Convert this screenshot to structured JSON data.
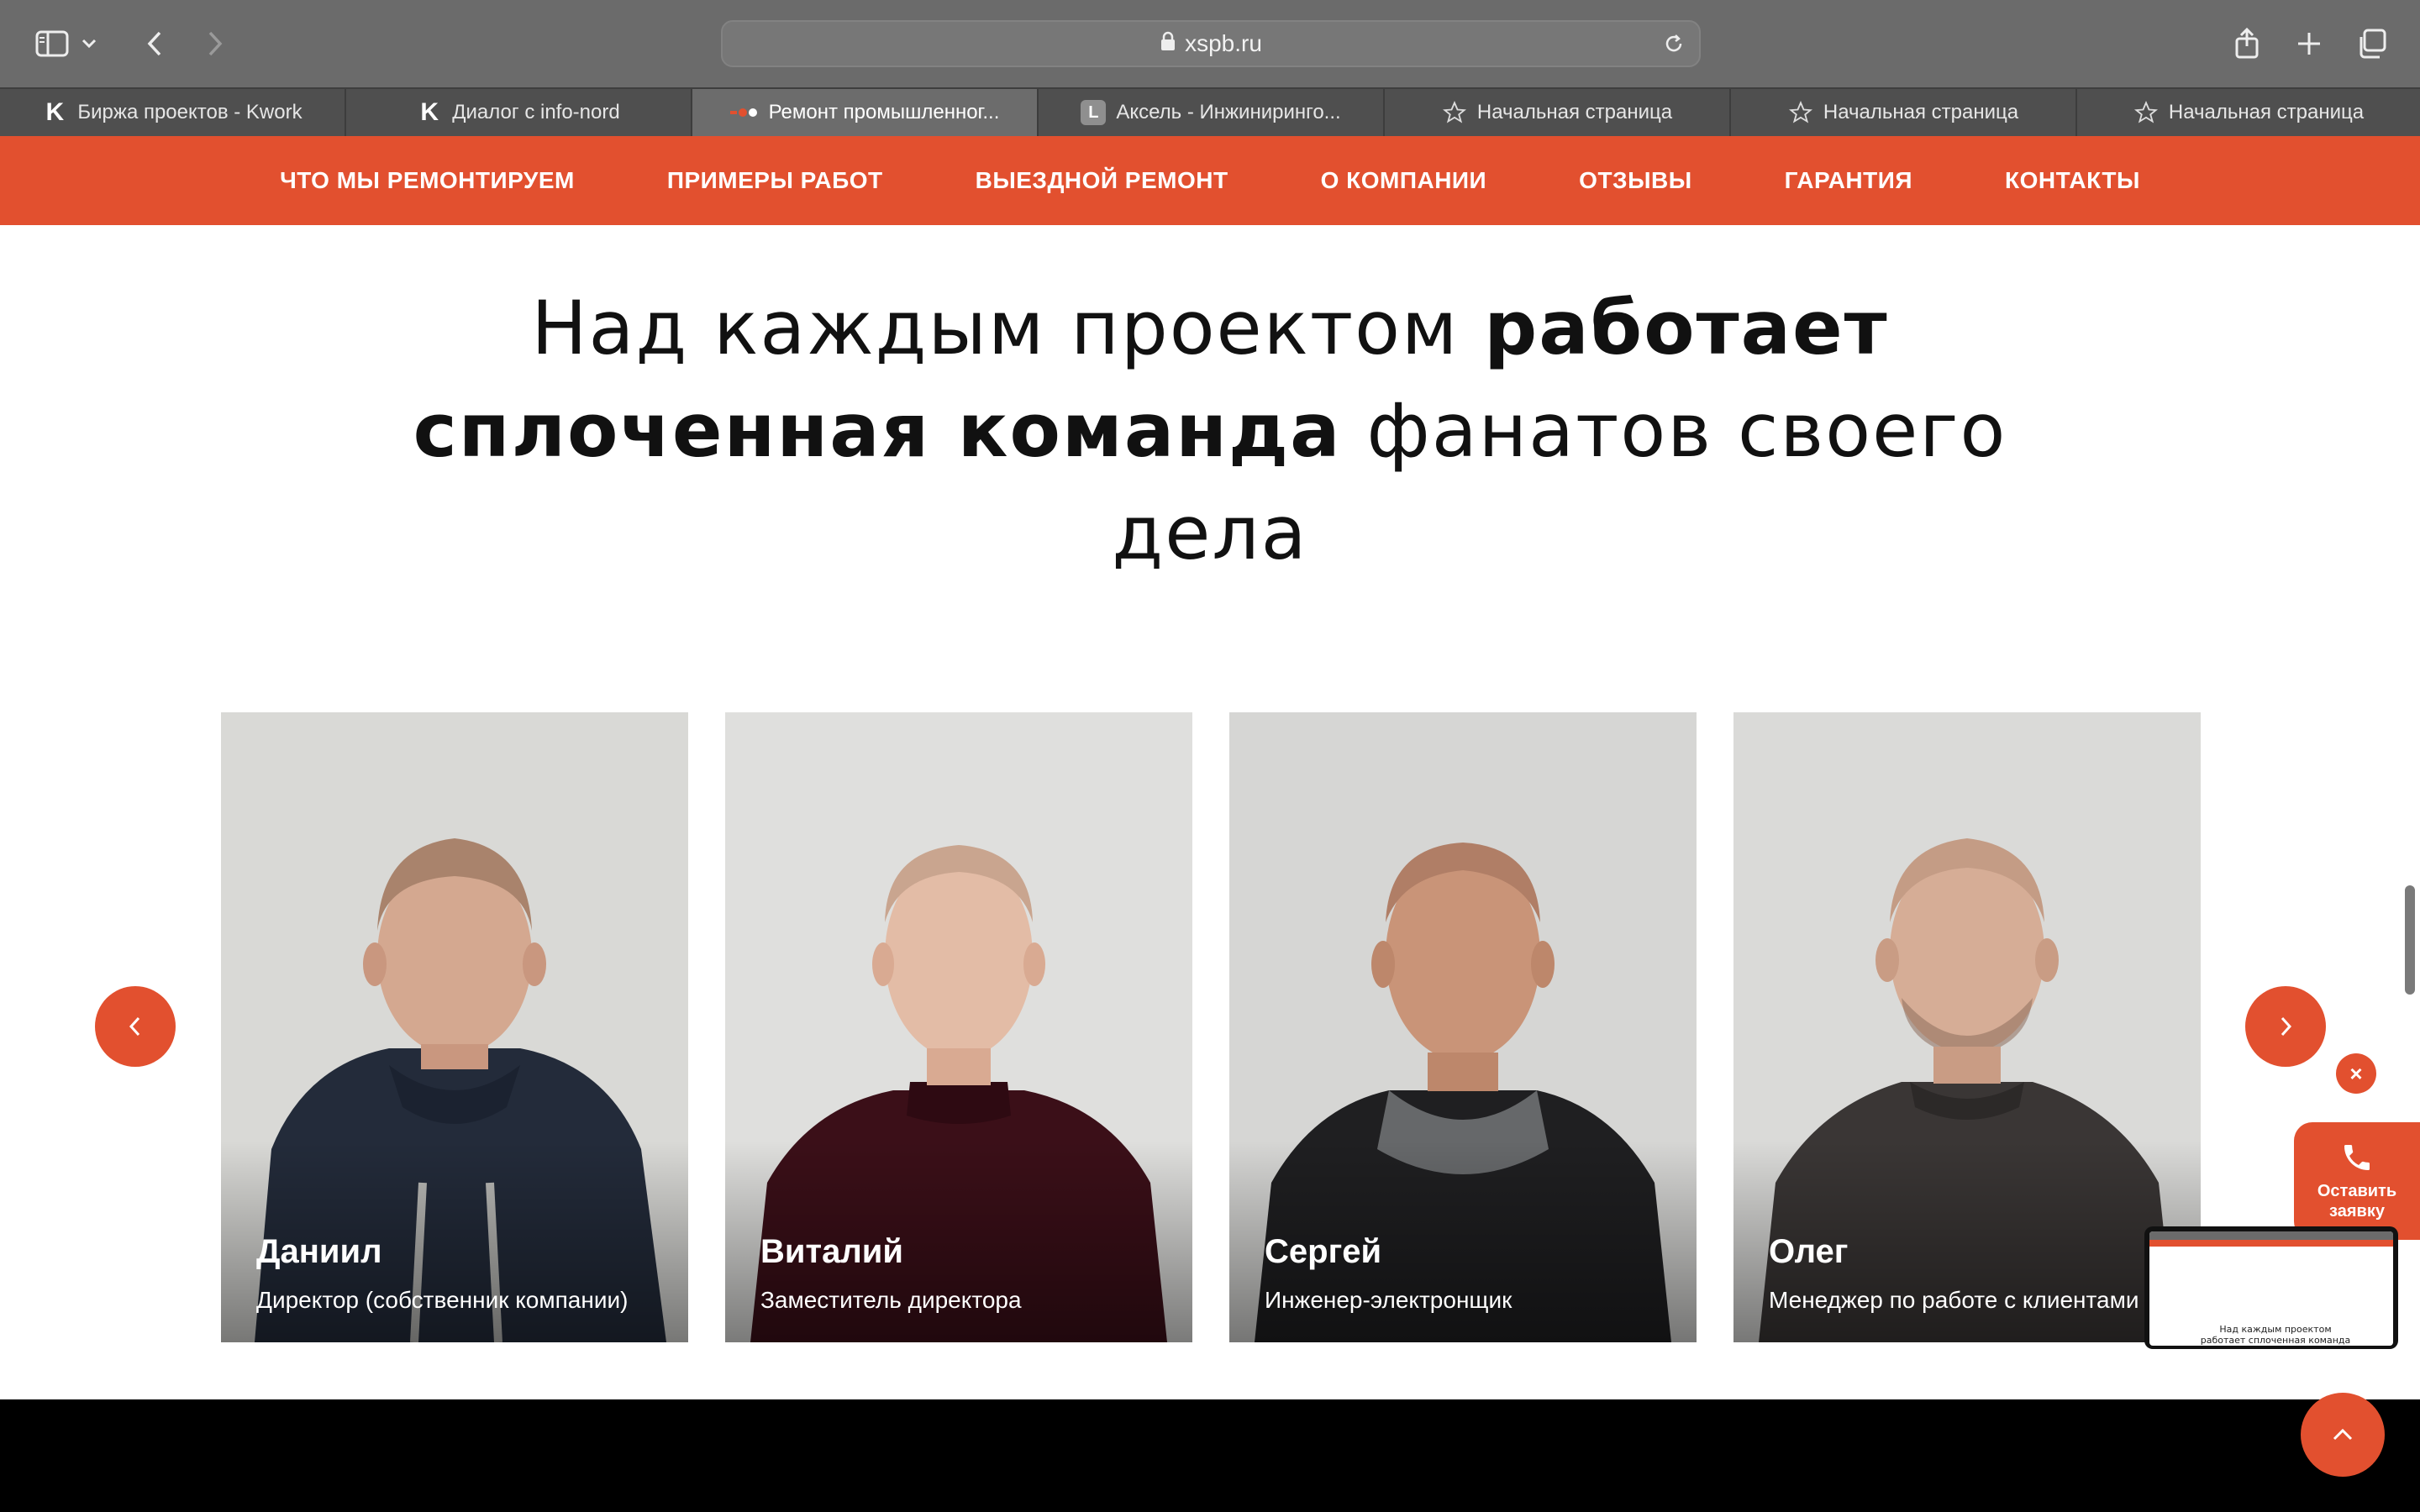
{
  "browser": {
    "url": "xspb.ru",
    "tabs": [
      {
        "label": "Биржа проектов - Kwork",
        "icon": "kwork-icon",
        "active": false
      },
      {
        "label": "Диалог с info-nord",
        "icon": "kwork-icon",
        "active": false
      },
      {
        "label": "Ремонт промышленног...",
        "icon": "site-icon",
        "active": true
      },
      {
        "label": "Аксель - Инжиниринго...",
        "icon": "l-icon",
        "active": false
      },
      {
        "label": "Начальная страница",
        "icon": "star-icon",
        "active": false
      },
      {
        "label": "Начальная страница",
        "icon": "star-icon",
        "active": false
      },
      {
        "label": "Начальная страница",
        "icon": "star-icon",
        "active": false
      }
    ]
  },
  "nav": {
    "items": [
      "ЧТО МЫ РЕМОНТИРУЕМ",
      "ПРИМЕРЫ РАБОТ",
      "ВЫЕЗДНОЙ РЕМОНТ",
      "О КОМПАНИИ",
      "ОТЗЫВЫ",
      "ГАРАНТИЯ",
      "КОНТАКТЫ"
    ]
  },
  "heading": {
    "part1": "Над каждым проектом ",
    "bold": "работает сплоченная команда",
    "part2": " фанатов своего дела"
  },
  "team": [
    {
      "name": "Даниил",
      "role": "Директор (собственник компании)"
    },
    {
      "name": "Виталий",
      "role": "Заместитель директора"
    },
    {
      "name": "Сергей",
      "role": "Инженер-электронщик"
    },
    {
      "name": "Олег",
      "role": "Менеджер по работе с клиентами"
    }
  ],
  "widget": {
    "request_line1": "Оставить",
    "request_line2": "заявку",
    "close_label": "×",
    "thumb_text": "Над каждым проектом работает сплоченная команда фанатов своего дела"
  },
  "colors": {
    "accent": "#e2502f",
    "chrome": "#6b6b6b"
  }
}
